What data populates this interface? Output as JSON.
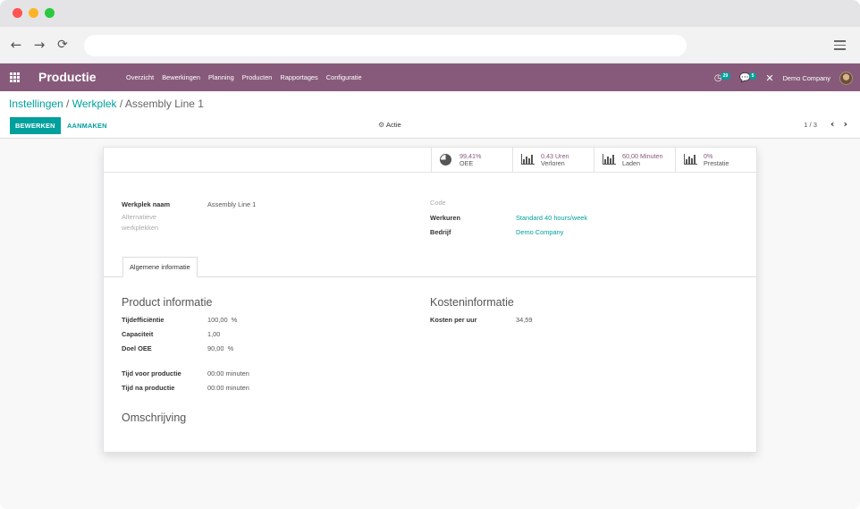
{
  "app": {
    "title": "Productie",
    "menu": [
      "Overzicht",
      "Bewerkingen",
      "Planning",
      "Producten",
      "Rapportages",
      "Configuratie"
    ],
    "activity_badge": "29",
    "messages_badge": "5",
    "company": "Demo Company"
  },
  "breadcrumb": {
    "part1": "Instellingen",
    "sep1": " / ",
    "part2": "Werkplek",
    "sep2": " / ",
    "current": "Assembly Line 1"
  },
  "buttons": {
    "edit": "BEWERKEN",
    "create": "AANMAKEN",
    "action": "Actie"
  },
  "pager": "1 / 3",
  "stats": [
    {
      "value": "99,41%",
      "label": "OEE",
      "icon": "pie-chart-icon"
    },
    {
      "value": "0,43 Uren",
      "label": "Verloren",
      "icon": "bar-chart-icon"
    },
    {
      "value": "60,00 Minuten",
      "label": "Laden",
      "icon": "bar-chart-icon"
    },
    {
      "value": "0%",
      "label": "Prestatie",
      "icon": "bar-chart-icon"
    }
  ],
  "form": {
    "name_label": "Werkplek naam",
    "name_value": "Assembly Line 1",
    "alt_label_1": "Alternatieve",
    "alt_label_2": "werkplekken",
    "code_label": "Code",
    "hours_label": "Werkuren",
    "hours_value": "Standard 40 hours/week",
    "company_label": "Bedrijf",
    "company_value": "Demo Company"
  },
  "tab": "Algemene informatie",
  "product_info": {
    "title": "Product informatie",
    "time_eff_label": "Tijdefficiëntie",
    "time_eff_value": "100,00",
    "time_eff_unit": "%",
    "capacity_label": "Capaciteit",
    "capacity_value": "1,00",
    "oee_label": "Doel OEE",
    "oee_value": "90,00",
    "oee_unit": "%",
    "before_label": "Tijd voor productie",
    "before_value": "00:00 minuten",
    "after_label": "Tijd na productie",
    "after_value": "00:00 minuten"
  },
  "cost_info": {
    "title": "Kosteninformatie",
    "cost_label": "Kosten per uur",
    "cost_value": "34,59"
  },
  "description_title": "Omschrijving"
}
